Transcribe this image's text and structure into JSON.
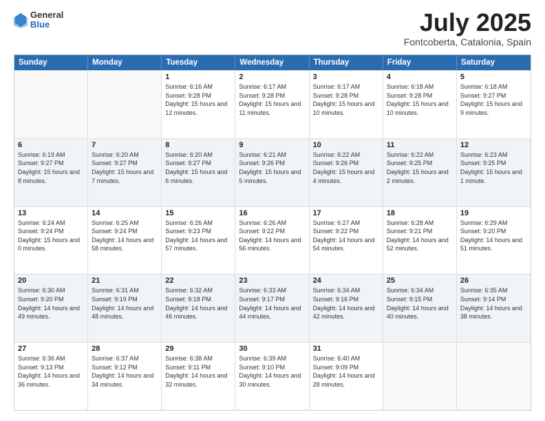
{
  "header": {
    "logo": {
      "line1": "General",
      "line2": "Blue"
    },
    "title": "July 2025",
    "subtitle": "Fontcoberta, Catalonia, Spain"
  },
  "calendar": {
    "days_of_week": [
      "Sunday",
      "Monday",
      "Tuesday",
      "Wednesday",
      "Thursday",
      "Friday",
      "Saturday"
    ],
    "rows": [
      [
        {
          "day": "",
          "empty": true
        },
        {
          "day": "",
          "empty": true
        },
        {
          "day": "1",
          "sunrise": "Sunrise: 6:16 AM",
          "sunset": "Sunset: 9:28 PM",
          "daylight": "Daylight: 15 hours and 12 minutes."
        },
        {
          "day": "2",
          "sunrise": "Sunrise: 6:17 AM",
          "sunset": "Sunset: 9:28 PM",
          "daylight": "Daylight: 15 hours and 11 minutes."
        },
        {
          "day": "3",
          "sunrise": "Sunrise: 6:17 AM",
          "sunset": "Sunset: 9:28 PM",
          "daylight": "Daylight: 15 hours and 10 minutes."
        },
        {
          "day": "4",
          "sunrise": "Sunrise: 6:18 AM",
          "sunset": "Sunset: 9:28 PM",
          "daylight": "Daylight: 15 hours and 10 minutes."
        },
        {
          "day": "5",
          "sunrise": "Sunrise: 6:18 AM",
          "sunset": "Sunset: 9:27 PM",
          "daylight": "Daylight: 15 hours and 9 minutes."
        }
      ],
      [
        {
          "day": "6",
          "sunrise": "Sunrise: 6:19 AM",
          "sunset": "Sunset: 9:27 PM",
          "daylight": "Daylight: 15 hours and 8 minutes."
        },
        {
          "day": "7",
          "sunrise": "Sunrise: 6:20 AM",
          "sunset": "Sunset: 9:27 PM",
          "daylight": "Daylight: 15 hours and 7 minutes."
        },
        {
          "day": "8",
          "sunrise": "Sunrise: 6:20 AM",
          "sunset": "Sunset: 9:27 PM",
          "daylight": "Daylight: 15 hours and 6 minutes."
        },
        {
          "day": "9",
          "sunrise": "Sunrise: 6:21 AM",
          "sunset": "Sunset: 9:26 PM",
          "daylight": "Daylight: 15 hours and 5 minutes."
        },
        {
          "day": "10",
          "sunrise": "Sunrise: 6:22 AM",
          "sunset": "Sunset: 9:26 PM",
          "daylight": "Daylight: 15 hours and 4 minutes."
        },
        {
          "day": "11",
          "sunrise": "Sunrise: 6:22 AM",
          "sunset": "Sunset: 9:25 PM",
          "daylight": "Daylight: 15 hours and 2 minutes."
        },
        {
          "day": "12",
          "sunrise": "Sunrise: 6:23 AM",
          "sunset": "Sunset: 9:25 PM",
          "daylight": "Daylight: 15 hours and 1 minute."
        }
      ],
      [
        {
          "day": "13",
          "sunrise": "Sunrise: 6:24 AM",
          "sunset": "Sunset: 9:24 PM",
          "daylight": "Daylight: 15 hours and 0 minutes."
        },
        {
          "day": "14",
          "sunrise": "Sunrise: 6:25 AM",
          "sunset": "Sunset: 9:24 PM",
          "daylight": "Daylight: 14 hours and 58 minutes."
        },
        {
          "day": "15",
          "sunrise": "Sunrise: 6:26 AM",
          "sunset": "Sunset: 9:23 PM",
          "daylight": "Daylight: 14 hours and 57 minutes."
        },
        {
          "day": "16",
          "sunrise": "Sunrise: 6:26 AM",
          "sunset": "Sunset: 9:22 PM",
          "daylight": "Daylight: 14 hours and 56 minutes."
        },
        {
          "day": "17",
          "sunrise": "Sunrise: 6:27 AM",
          "sunset": "Sunset: 9:22 PM",
          "daylight": "Daylight: 14 hours and 54 minutes."
        },
        {
          "day": "18",
          "sunrise": "Sunrise: 6:28 AM",
          "sunset": "Sunset: 9:21 PM",
          "daylight": "Daylight: 14 hours and 52 minutes."
        },
        {
          "day": "19",
          "sunrise": "Sunrise: 6:29 AM",
          "sunset": "Sunset: 9:20 PM",
          "daylight": "Daylight: 14 hours and 51 minutes."
        }
      ],
      [
        {
          "day": "20",
          "sunrise": "Sunrise: 6:30 AM",
          "sunset": "Sunset: 9:20 PM",
          "daylight": "Daylight: 14 hours and 49 minutes."
        },
        {
          "day": "21",
          "sunrise": "Sunrise: 6:31 AM",
          "sunset": "Sunset: 9:19 PM",
          "daylight": "Daylight: 14 hours and 48 minutes."
        },
        {
          "day": "22",
          "sunrise": "Sunrise: 6:32 AM",
          "sunset": "Sunset: 9:18 PM",
          "daylight": "Daylight: 14 hours and 46 minutes."
        },
        {
          "day": "23",
          "sunrise": "Sunrise: 6:33 AM",
          "sunset": "Sunset: 9:17 PM",
          "daylight": "Daylight: 14 hours and 44 minutes."
        },
        {
          "day": "24",
          "sunrise": "Sunrise: 6:34 AM",
          "sunset": "Sunset: 9:16 PM",
          "daylight": "Daylight: 14 hours and 42 minutes."
        },
        {
          "day": "25",
          "sunrise": "Sunrise: 6:34 AM",
          "sunset": "Sunset: 9:15 PM",
          "daylight": "Daylight: 14 hours and 40 minutes."
        },
        {
          "day": "26",
          "sunrise": "Sunrise: 6:35 AM",
          "sunset": "Sunset: 9:14 PM",
          "daylight": "Daylight: 14 hours and 38 minutes."
        }
      ],
      [
        {
          "day": "27",
          "sunrise": "Sunrise: 6:36 AM",
          "sunset": "Sunset: 9:13 PM",
          "daylight": "Daylight: 14 hours and 36 minutes."
        },
        {
          "day": "28",
          "sunrise": "Sunrise: 6:37 AM",
          "sunset": "Sunset: 9:12 PM",
          "daylight": "Daylight: 14 hours and 34 minutes."
        },
        {
          "day": "29",
          "sunrise": "Sunrise: 6:38 AM",
          "sunset": "Sunset: 9:11 PM",
          "daylight": "Daylight: 14 hours and 32 minutes."
        },
        {
          "day": "30",
          "sunrise": "Sunrise: 6:39 AM",
          "sunset": "Sunset: 9:10 PM",
          "daylight": "Daylight: 14 hours and 30 minutes."
        },
        {
          "day": "31",
          "sunrise": "Sunrise: 6:40 AM",
          "sunset": "Sunset: 9:09 PM",
          "daylight": "Daylight: 14 hours and 28 minutes."
        },
        {
          "day": "",
          "empty": true
        },
        {
          "day": "",
          "empty": true
        }
      ]
    ]
  }
}
